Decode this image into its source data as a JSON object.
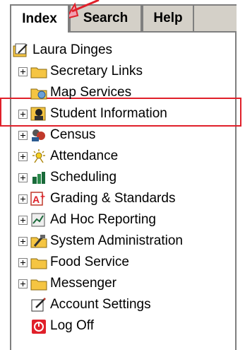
{
  "tabs": [
    {
      "label": "Index",
      "active": true
    },
    {
      "label": "Search",
      "active": false
    },
    {
      "label": "Help",
      "active": false
    }
  ],
  "tree": {
    "root": {
      "label": "Laura Dinges",
      "icon": "edit-folder-icon"
    },
    "items": [
      {
        "label": "Secretary Links",
        "icon": "folder-icon",
        "expandable": true
      },
      {
        "label": "Map Services",
        "icon": "map-folder-icon",
        "expandable": false
      },
      {
        "label": "Student Information",
        "icon": "student-icon",
        "expandable": true
      },
      {
        "label": "Census",
        "icon": "census-icon",
        "expandable": true
      },
      {
        "label": "Attendance",
        "icon": "attendance-icon",
        "expandable": true
      },
      {
        "label": "Scheduling",
        "icon": "scheduling-icon",
        "expandable": true
      },
      {
        "label": "Grading & Standards",
        "icon": "grading-icon",
        "expandable": true
      },
      {
        "label": "Ad Hoc Reporting",
        "icon": "report-icon",
        "expandable": true
      },
      {
        "label": "System Administration",
        "icon": "admin-tools-icon",
        "expandable": true
      },
      {
        "label": "Food Service",
        "icon": "folder-icon",
        "expandable": true
      },
      {
        "label": "Messenger",
        "icon": "folder-icon",
        "expandable": true
      },
      {
        "label": "Account Settings",
        "icon": "settings-pencil-icon",
        "expandable": false
      },
      {
        "label": "Log Off",
        "icon": "power-icon",
        "expandable": false
      }
    ]
  },
  "colors": {
    "annotation": "#e0202a",
    "folder": "#f5c542",
    "tab": "#d4d0c8"
  }
}
